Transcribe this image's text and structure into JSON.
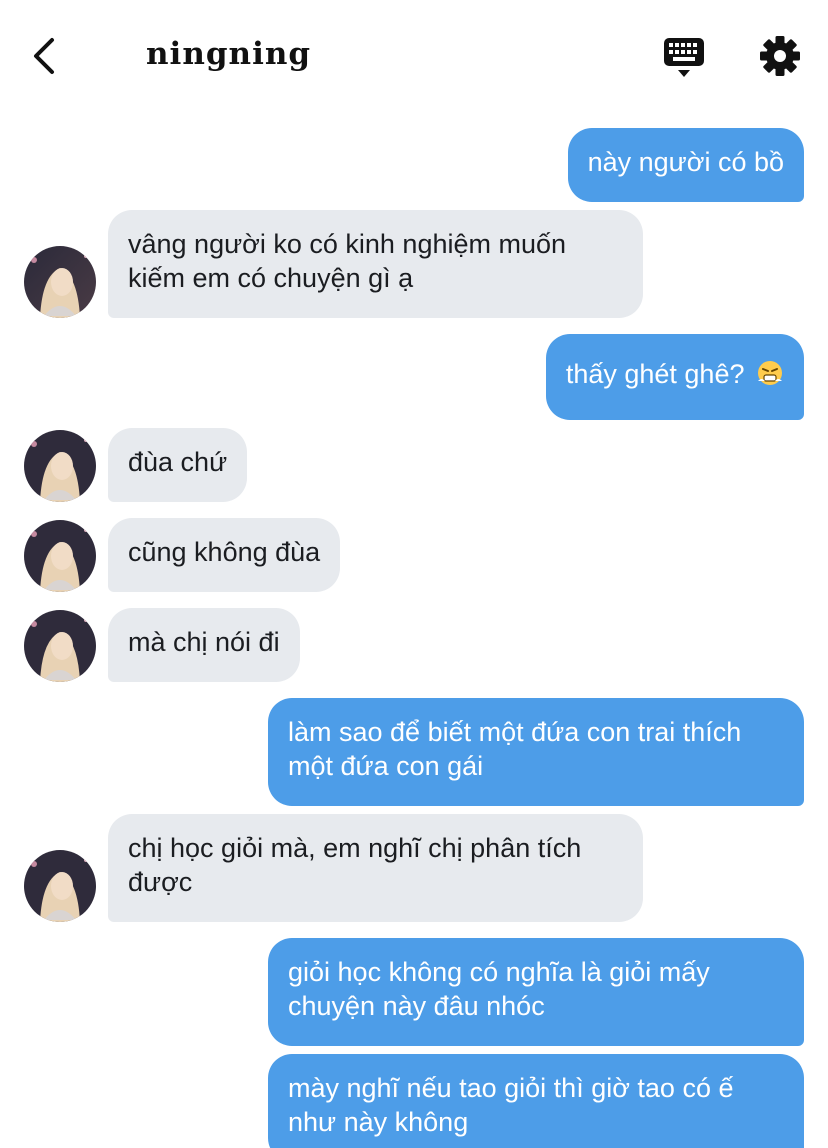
{
  "header": {
    "title": "ningning",
    "back_icon": "chevron-left-icon",
    "keyboard_icon": "keyboard-icon",
    "settings_icon": "gear-icon"
  },
  "colors": {
    "outgoing_bubble": "#4d9de8",
    "incoming_bubble": "#e7eaee",
    "text_dark": "#1b1d21"
  },
  "messages": [
    {
      "from": "me",
      "text": "này người có bồ"
    },
    {
      "from": "ningning",
      "text": "vâng người ko có kinh nghiệm muốn kiếm em có chuyện gì ạ"
    },
    {
      "from": "me",
      "text": "thấy ghét ghê?",
      "emoji": "angry-face-emoji"
    },
    {
      "from": "ningning",
      "text": "đùa chứ"
    },
    {
      "from": "ningning",
      "text": "cũng không đùa"
    },
    {
      "from": "ningning",
      "text": "mà chị nói đi"
    },
    {
      "from": "me",
      "text": "làm sao để biết một đứa con trai thích một đứa con gái"
    },
    {
      "from": "ningning",
      "text": "chị học giỏi mà, em nghĩ chị phân tích được"
    },
    {
      "from": "me",
      "text": "giỏi học không có nghĩa là giỏi mấy chuyện này đâu nhóc"
    },
    {
      "from": "me",
      "text": "mày nghĩ nếu tao giỏi thì giờ tao có ế như này không"
    }
  ]
}
